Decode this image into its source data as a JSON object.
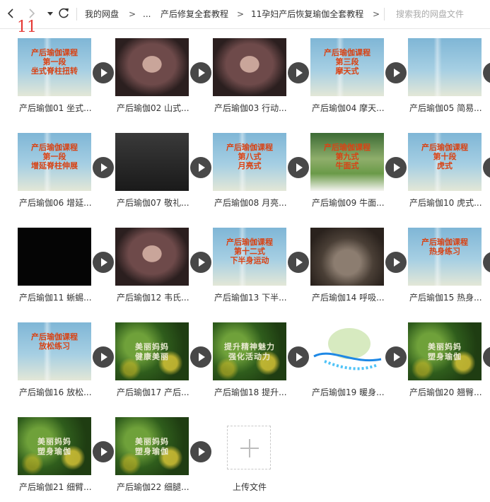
{
  "nav": {
    "breadcrumbs": [
      "我的网盘",
      "...",
      "产后修复全套教程",
      "11孕妇产后恢复瑜伽全套教程"
    ],
    "separator": ">",
    "search_placeholder": "搜索我的网盘文件"
  },
  "annotation_mark": "11",
  "files": [
    {
      "caption": "产后瑜伽01 坐式...",
      "thumb": "yoga",
      "thumb_text": "产后瑜伽课程\n第一段\n坐式脊柱扭转"
    },
    {
      "caption": "产后瑜伽02 山式...",
      "thumb": "woman",
      "thumb_text": ""
    },
    {
      "caption": "产后瑜伽03 行动...",
      "thumb": "woman",
      "thumb_text": ""
    },
    {
      "caption": "产后瑜伽04 摩天...",
      "thumb": "yoga",
      "thumb_text": "产后瑜伽课程\n第三段\n摩天式"
    },
    {
      "caption": "产后瑜伽05 简易...",
      "thumb": "yoga",
      "thumb_text": ""
    },
    {
      "caption": "产后瑜伽06 增延...",
      "thumb": "yoga",
      "thumb_text": "产后瑜伽课程\n第一段\n增延脊柱伸展"
    },
    {
      "caption": "产后瑜伽07 敬礼...",
      "thumb": "dark",
      "thumb_text": ""
    },
    {
      "caption": "产后瑜伽08 月亮...",
      "thumb": "yoga",
      "thumb_text": "产后瑜伽课程\n第八式\n月亮式"
    },
    {
      "caption": "产后瑜伽09 牛面...",
      "thumb": "garden",
      "thumb_text": "产后瑜伽课程\n第九式\n牛面式"
    },
    {
      "caption": "产后瑜伽10 虎式...",
      "thumb": "yoga",
      "thumb_text": "产后瑜伽课程\n第十段\n虎式"
    },
    {
      "caption": "产后瑜伽11 蜥蜴...",
      "thumb": "black",
      "thumb_text": ""
    },
    {
      "caption": "产后瑜伽12 韦氏...",
      "thumb": "woman",
      "thumb_text": ""
    },
    {
      "caption": "产后瑜伽13 下半...",
      "thumb": "yoga",
      "thumb_text": "产后瑜伽课程\n第十二式\n下半身运动"
    },
    {
      "caption": "产后瑜伽14 呼吸...",
      "thumb": "room",
      "thumb_text": ""
    },
    {
      "caption": "产后瑜伽15 热身...",
      "thumb": "yoga",
      "thumb_text": "产后瑜伽课程\n热身练习"
    },
    {
      "caption": "产后瑜伽16 放松...",
      "thumb": "yoga",
      "thumb_text": "产后瑜伽课程\n放松练习"
    },
    {
      "caption": "产后瑜伽17 产后...",
      "thumb": "flower",
      "thumb_text": "美丽妈妈\n健康美丽"
    },
    {
      "caption": "产后瑜伽18 提升...",
      "thumb": "flower",
      "thumb_text": "提升精神魅力\n强化活动力"
    },
    {
      "caption": "产后瑜伽19 暖身...",
      "thumb": "white",
      "thumb_text": ""
    },
    {
      "caption": "产后瑜伽20 翘臀...",
      "thumb": "flower",
      "thumb_text": "美丽妈妈\n塑身瑜伽"
    },
    {
      "caption": "产后瑜伽21 细臂...",
      "thumb": "flower",
      "thumb_text": "美丽妈妈\n塑身瑜伽"
    },
    {
      "caption": "产后瑜伽22 细腿...",
      "thumb": "flower",
      "thumb_text": "美丽妈妈\n塑身瑜伽"
    }
  ],
  "upload": {
    "label": "上传文件"
  }
}
